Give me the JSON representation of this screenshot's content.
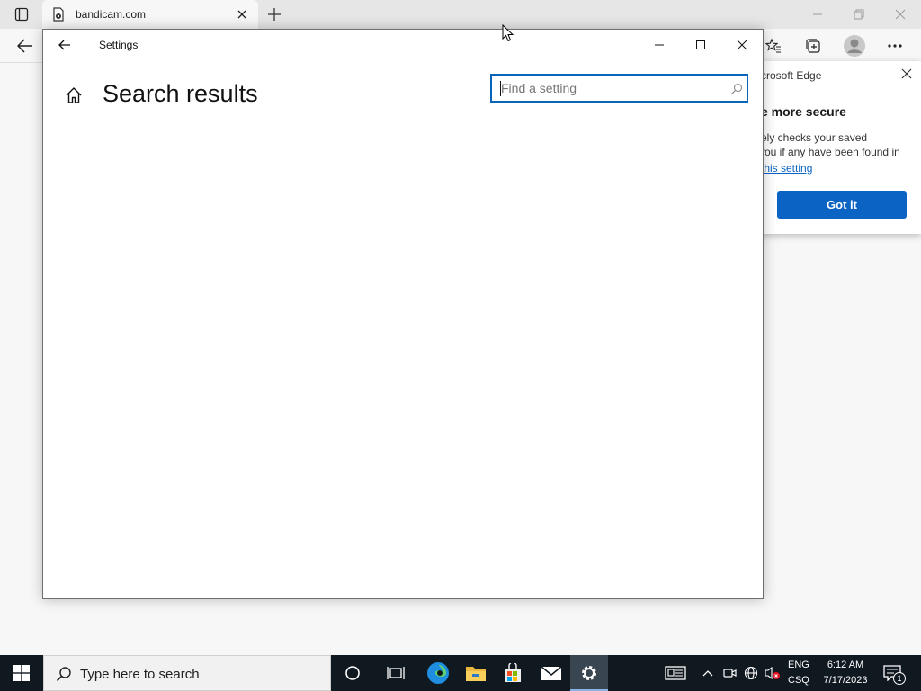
{
  "browser": {
    "tab": {
      "title": "bandicam.com"
    },
    "notification": {
      "header": "crosoft Edge",
      "title": "e more secure",
      "line1": "ely checks your saved",
      "line2": "rou if any have been found in",
      "link": "this setting",
      "button": "Got it"
    }
  },
  "settings": {
    "window_title": "Settings",
    "page_title": "Search results",
    "search": {
      "placeholder": "Find a setting",
      "value": ""
    }
  },
  "taskbar": {
    "search_placeholder": "Type here to search",
    "language": {
      "code": "ENG",
      "layout": "CSQ"
    },
    "clock": {
      "time": "6:12 AM",
      "date": "7/17/2023"
    },
    "notifications_count": "1",
    "apps": [
      "cortana",
      "task-view",
      "edge",
      "file-explorer",
      "store",
      "mail",
      "settings"
    ],
    "active_app": "settings"
  },
  "colors": {
    "accent": "#0a64b8",
    "taskbar_bg": "#101820",
    "got_it_button": "#0b63c4"
  }
}
